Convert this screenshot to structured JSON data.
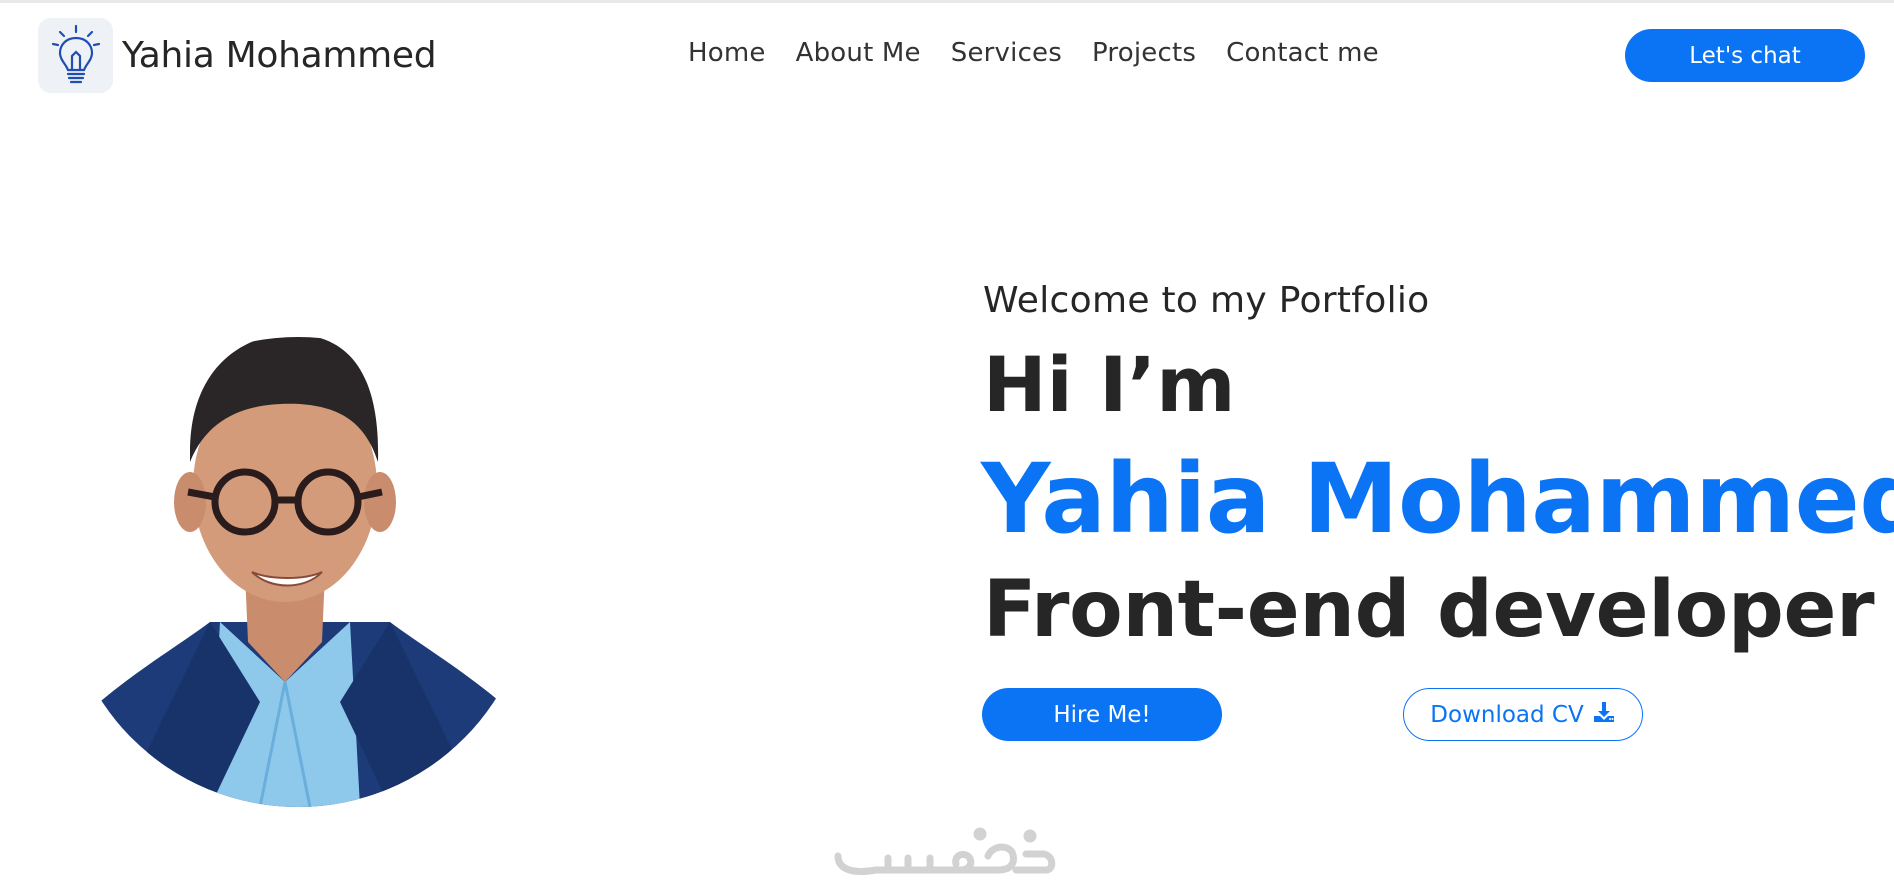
{
  "header": {
    "brand_name": "Yahia Mohammed",
    "logo_icon": "lightbulb-icon",
    "nav": [
      "Home",
      "About Me",
      "Services",
      "Projects",
      "Contact me"
    ],
    "cta_label": "Let's chat"
  },
  "hero": {
    "welcome": "Welcome to my Portfolio",
    "greeting": "Hi I’m",
    "name": "Yahia Mohammed",
    "role": "Front-end developer",
    "hire_label": "Hire Me!",
    "cv_label": "Download CV",
    "cv_icon": "download-icon",
    "photo": "profile-photo"
  },
  "watermark": {
    "text": "خمسات"
  },
  "colors": {
    "accent": "#0b74f5",
    "text": "#262626",
    "background": "#ffffff"
  }
}
